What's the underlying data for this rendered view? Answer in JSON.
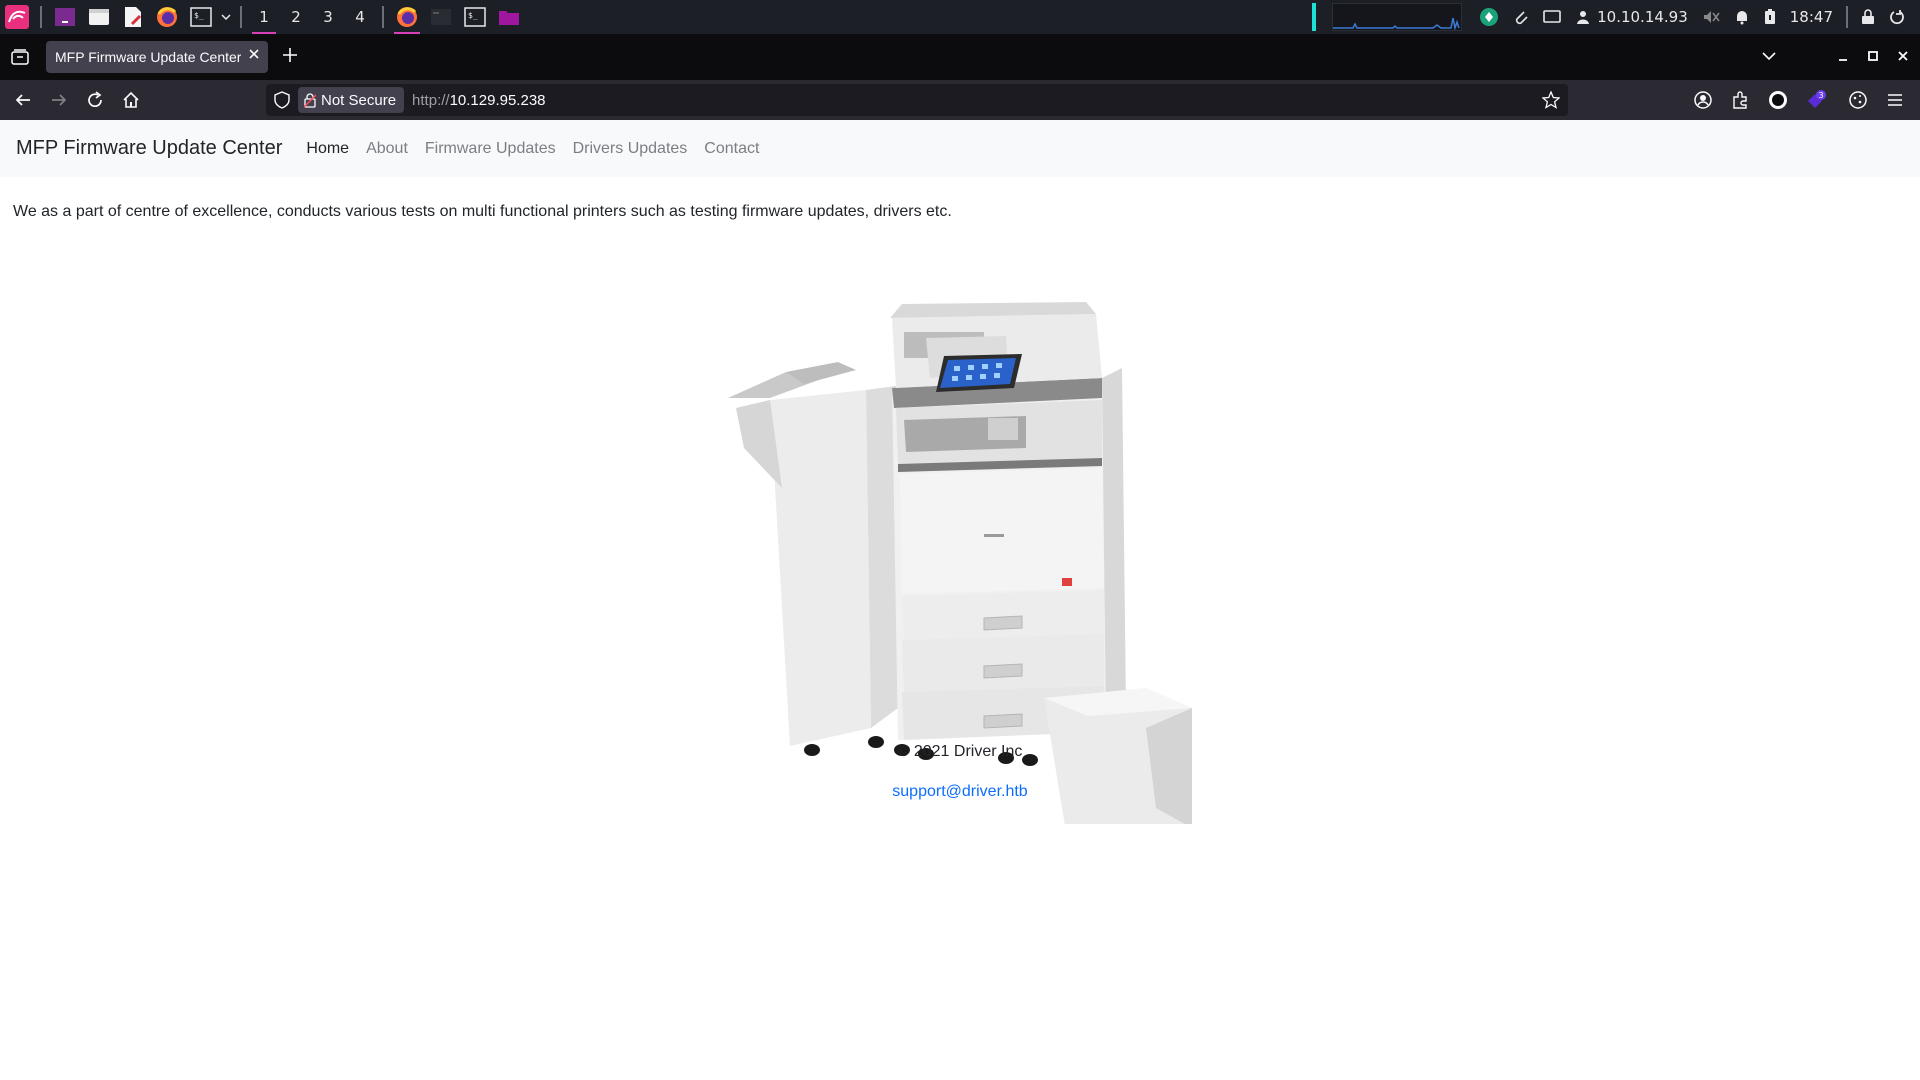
{
  "taskbar": {
    "workspaces": [
      "1",
      "2",
      "3",
      "4"
    ],
    "ip": "10.10.14.93",
    "time": "18:47"
  },
  "browser": {
    "tab_title": "MFP Firmware Update Center",
    "security_label": "Not Secure",
    "url_scheme": "http://",
    "url_host": "10.129.95.238",
    "extension_badge": "3"
  },
  "site": {
    "brand": "MFP Firmware Update Center",
    "nav": [
      "Home",
      "About",
      "Firmware Updates",
      "Drivers Updates",
      "Contact"
    ],
    "intro": "We as a part of centre of excellence, conducts various tests on multi functional printers such as testing firmware updates, drivers etc.",
    "copyright": "© 2021 Driver Inc",
    "email": "support@driver.htb"
  },
  "colors": {
    "accent": "#d640b8",
    "link": "#0d6efd",
    "tab_bg": "#42414d"
  }
}
